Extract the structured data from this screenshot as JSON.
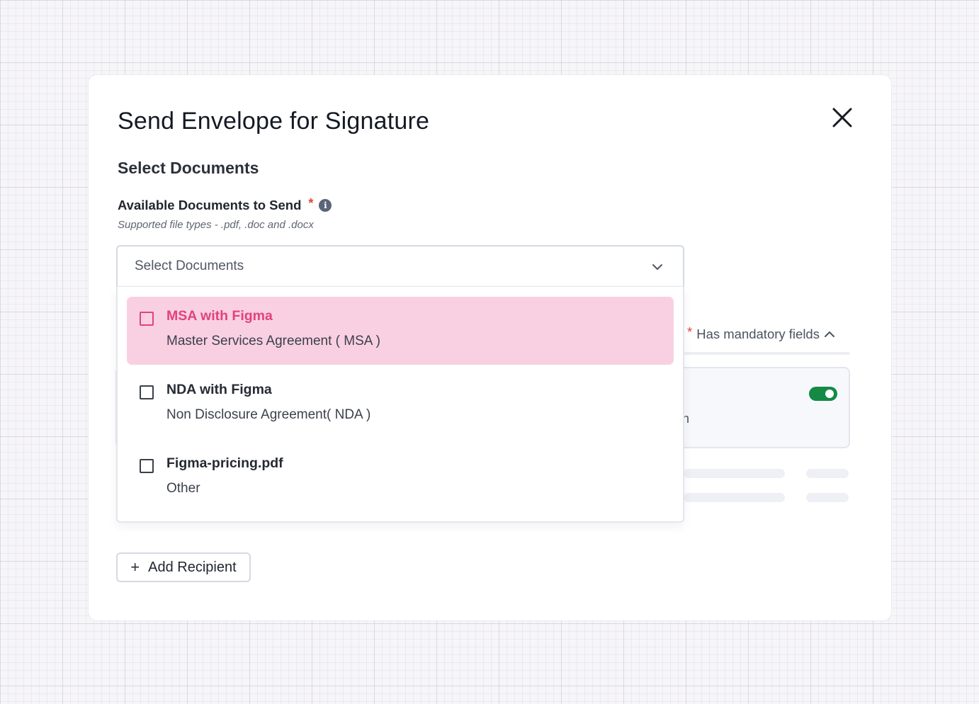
{
  "modal": {
    "title": "Send Envelope for Signature",
    "section_title": "Select Documents",
    "field_label": "Available Documents to Send",
    "required_mark": "*",
    "info_icon": "info-icon",
    "hint": "Supported file types - .pdf, .doc and .docx"
  },
  "select": {
    "placeholder": "Select Documents",
    "options": [
      {
        "name": "MSA with Figma",
        "type": "Master Services Agreement ( MSA )",
        "highlighted": true
      },
      {
        "name": "NDA with Figma",
        "type": "Non Disclosure Agreement( NDA )",
        "highlighted": false
      },
      {
        "name": "Figma-pricing.pdf",
        "type": "Other",
        "highlighted": false
      }
    ]
  },
  "background_panel": {
    "mandatory_label": "Has mandatory fields",
    "mandatory_star": "*",
    "card_fragment": "n",
    "toggle_on": true
  },
  "actions": {
    "add_recipient_label": "Add Recipient",
    "plus_icon": "plus-icon"
  },
  "colors": {
    "accent_pink": "#e2427a",
    "highlight_bg": "#f9d0e2",
    "toggle_green": "#148a45",
    "required_red": "#e0473c"
  }
}
